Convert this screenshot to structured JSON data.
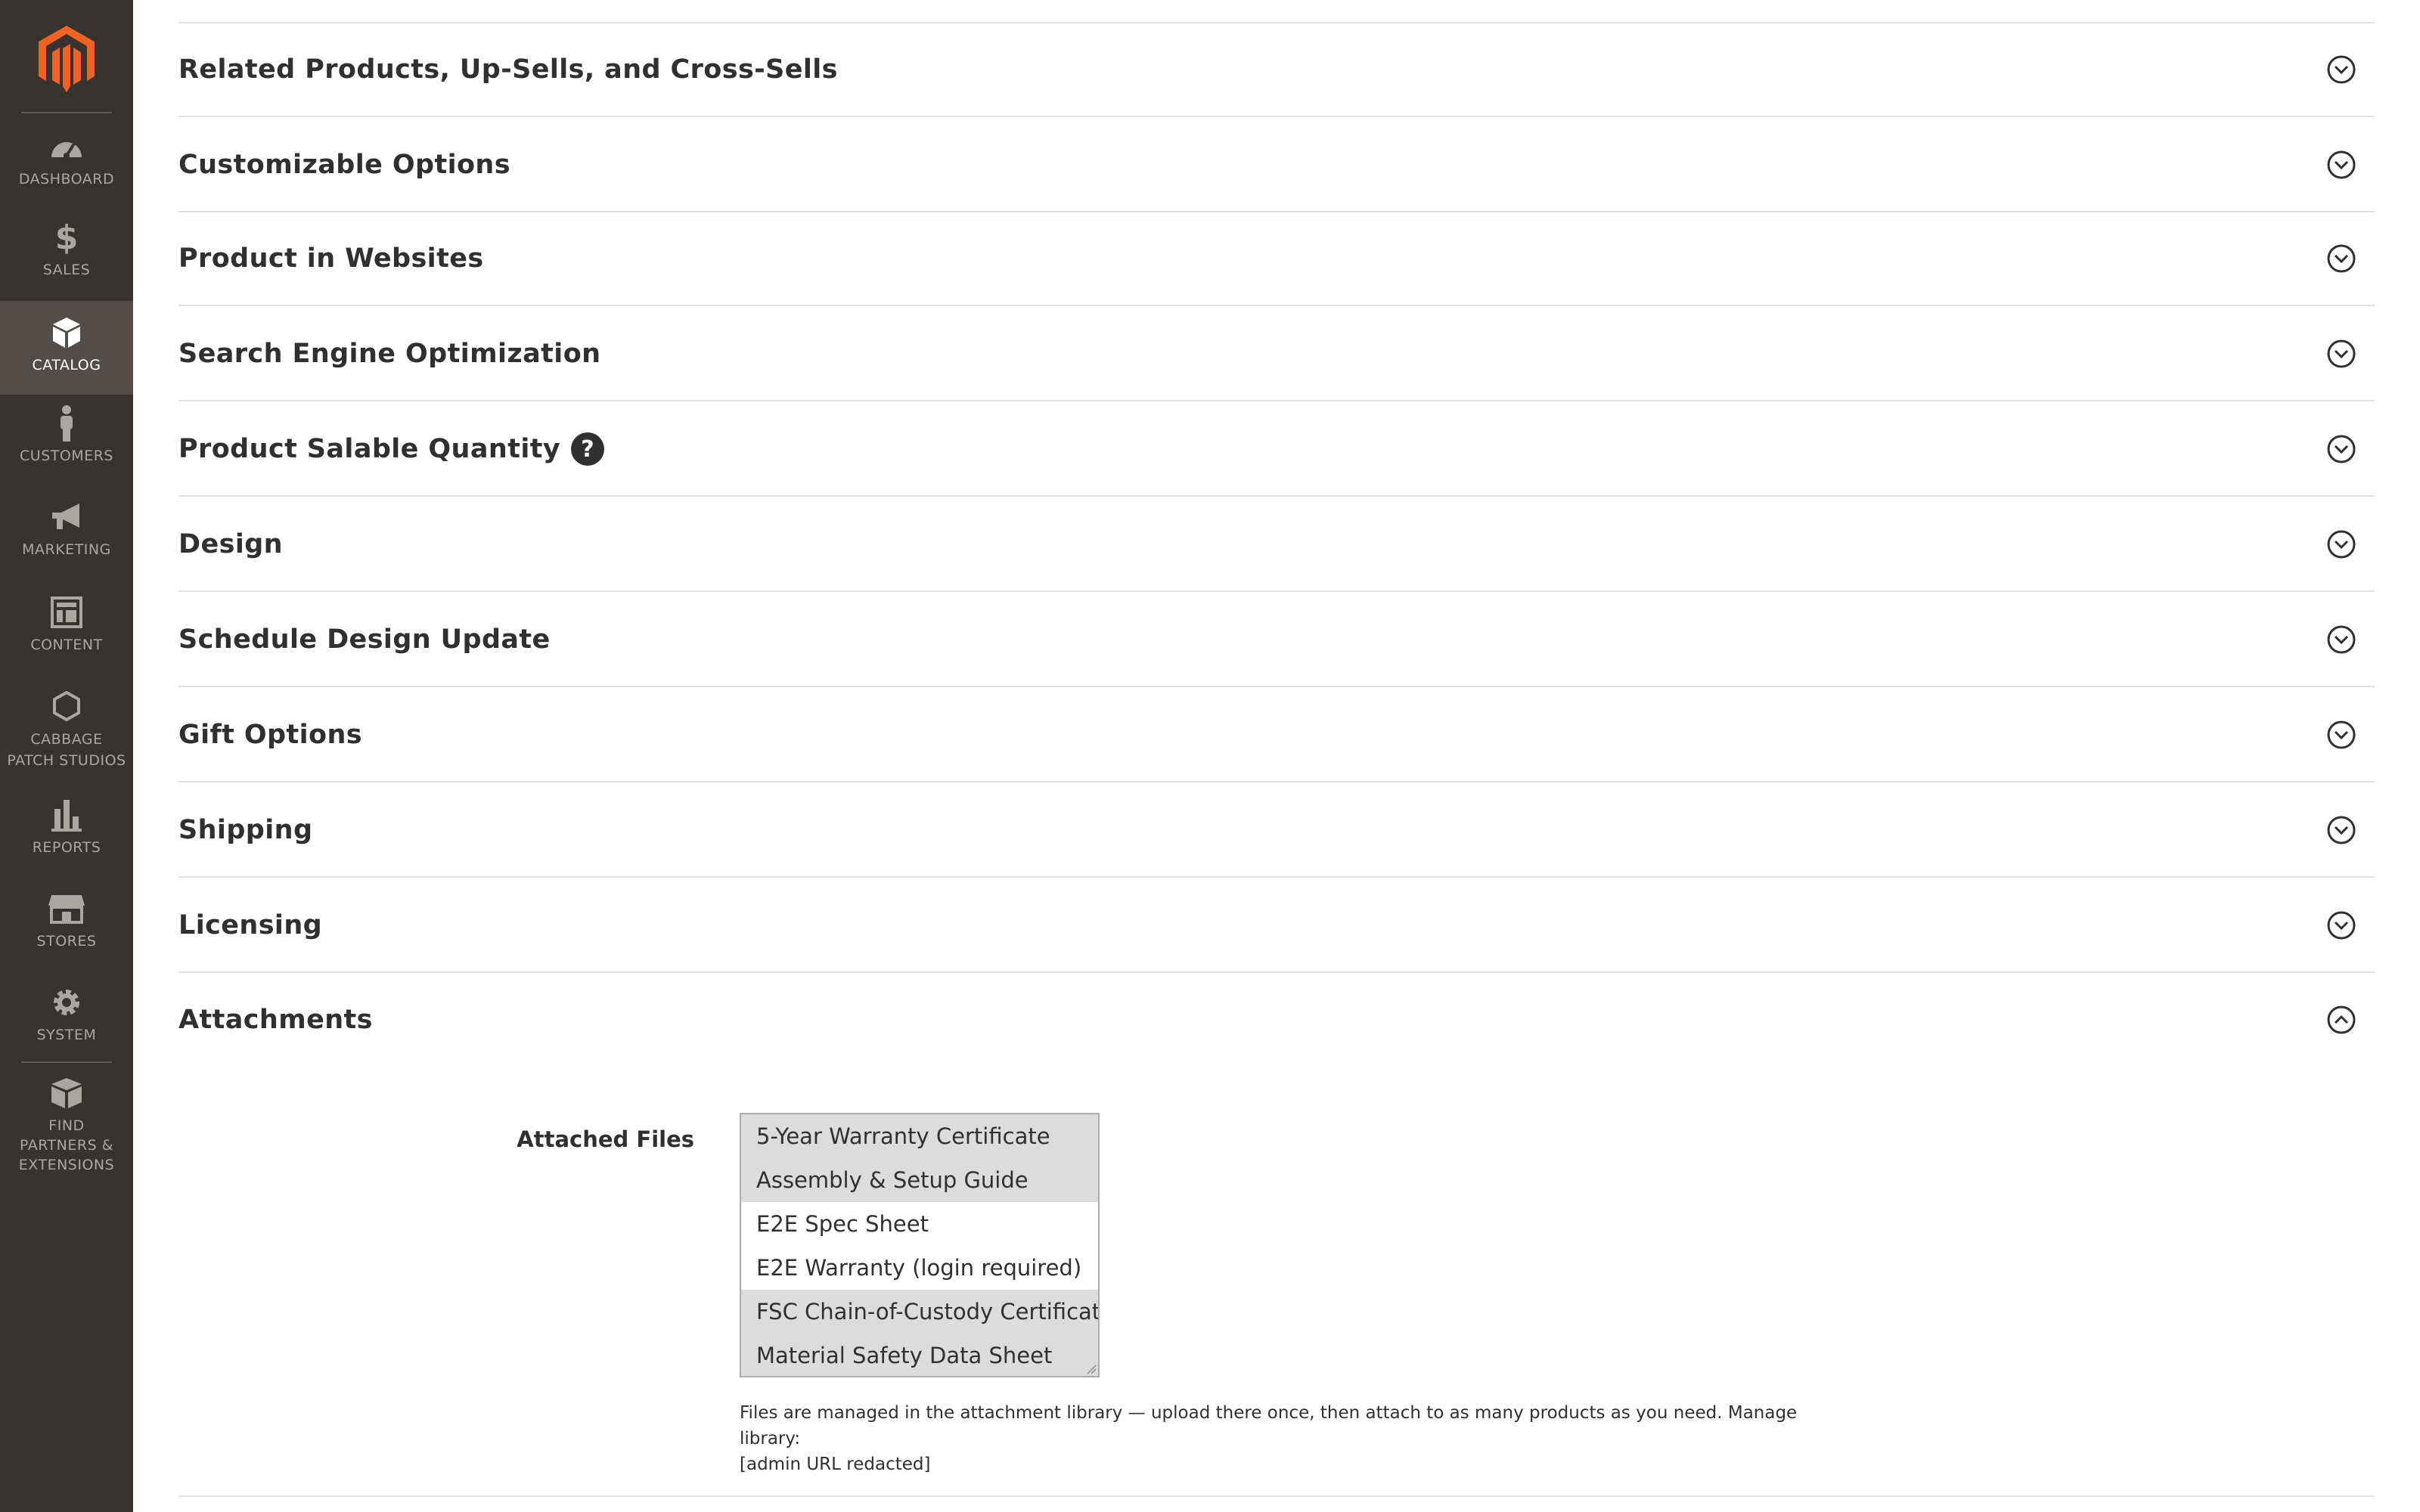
{
  "sidebar": {
    "items": [
      {
        "label": "DASHBOARD",
        "icon": "dashboard-icon"
      },
      {
        "label": "SALES",
        "icon": "dollar-icon"
      },
      {
        "label": "CATALOG",
        "icon": "cube-icon",
        "active": true
      },
      {
        "label": "CUSTOMERS",
        "icon": "person-icon"
      },
      {
        "label": "MARKETING",
        "icon": "megaphone-icon"
      },
      {
        "label": "CONTENT",
        "icon": "layout-icon"
      },
      {
        "label_line1": "CABBAGE",
        "label_line2": "PATCH STUDIOS",
        "icon": "hexagon-icon"
      },
      {
        "label": "REPORTS",
        "icon": "bar-chart-icon"
      },
      {
        "label": "STORES",
        "icon": "storefront-icon"
      },
      {
        "label": "SYSTEM",
        "icon": "gear-icon"
      },
      {
        "label_line1": "FIND",
        "label_line2": "PARTNERS &",
        "label_line3": "EXTENSIONS",
        "icon": "boxes-icon"
      }
    ]
  },
  "sections": [
    {
      "title": "Related Products, Up-Sells, and Cross-Sells"
    },
    {
      "title": "Customizable Options"
    },
    {
      "title": "Product in Websites"
    },
    {
      "title": "Search Engine Optimization"
    },
    {
      "title": "Product Salable Quantity",
      "help": "?"
    },
    {
      "title": "Design"
    },
    {
      "title": "Schedule Design Update"
    },
    {
      "title": "Gift Options"
    },
    {
      "title": "Shipping"
    },
    {
      "title": "Licensing"
    },
    {
      "title": "Attachments",
      "expanded": true
    }
  ],
  "attachments": {
    "label": "Attached Files",
    "options": [
      {
        "text": "5-Year Warranty Certificate",
        "selected": true
      },
      {
        "text": "Assembly & Setup Guide",
        "selected": true
      },
      {
        "text": "E2E Spec Sheet",
        "selected": false
      },
      {
        "text": "E2E Warranty (login required)",
        "selected": false
      },
      {
        "text": "FSC Chain-of-Custody Certificate",
        "selected": true
      },
      {
        "text": "Material Safety Data Sheet",
        "selected": true
      }
    ],
    "note_line1": "Files are managed in the attachment library — upload there once, then attach to as many products as you need. Manage library:",
    "note_line2": "[admin URL redacted]"
  },
  "colors": {
    "sidebar_bg": "#373330",
    "sidebar_active": "#524d49",
    "logo_orange": "#f26322"
  }
}
